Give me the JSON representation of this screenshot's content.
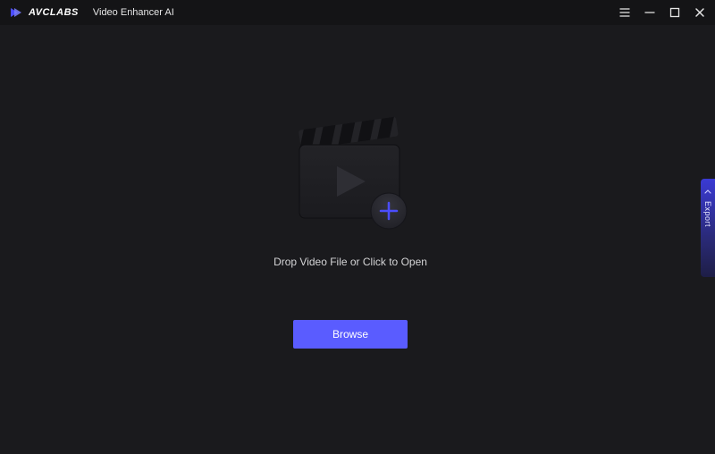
{
  "titlebar": {
    "brand": "AVCLABS",
    "app_title": "Video Enhancer AI"
  },
  "main": {
    "drop_label": "Drop Video File or Click to Open",
    "browse_label": "Browse"
  },
  "side": {
    "export_label": "Export"
  },
  "colors": {
    "accent": "#5a5cff",
    "bg": "#1a1a1d"
  }
}
